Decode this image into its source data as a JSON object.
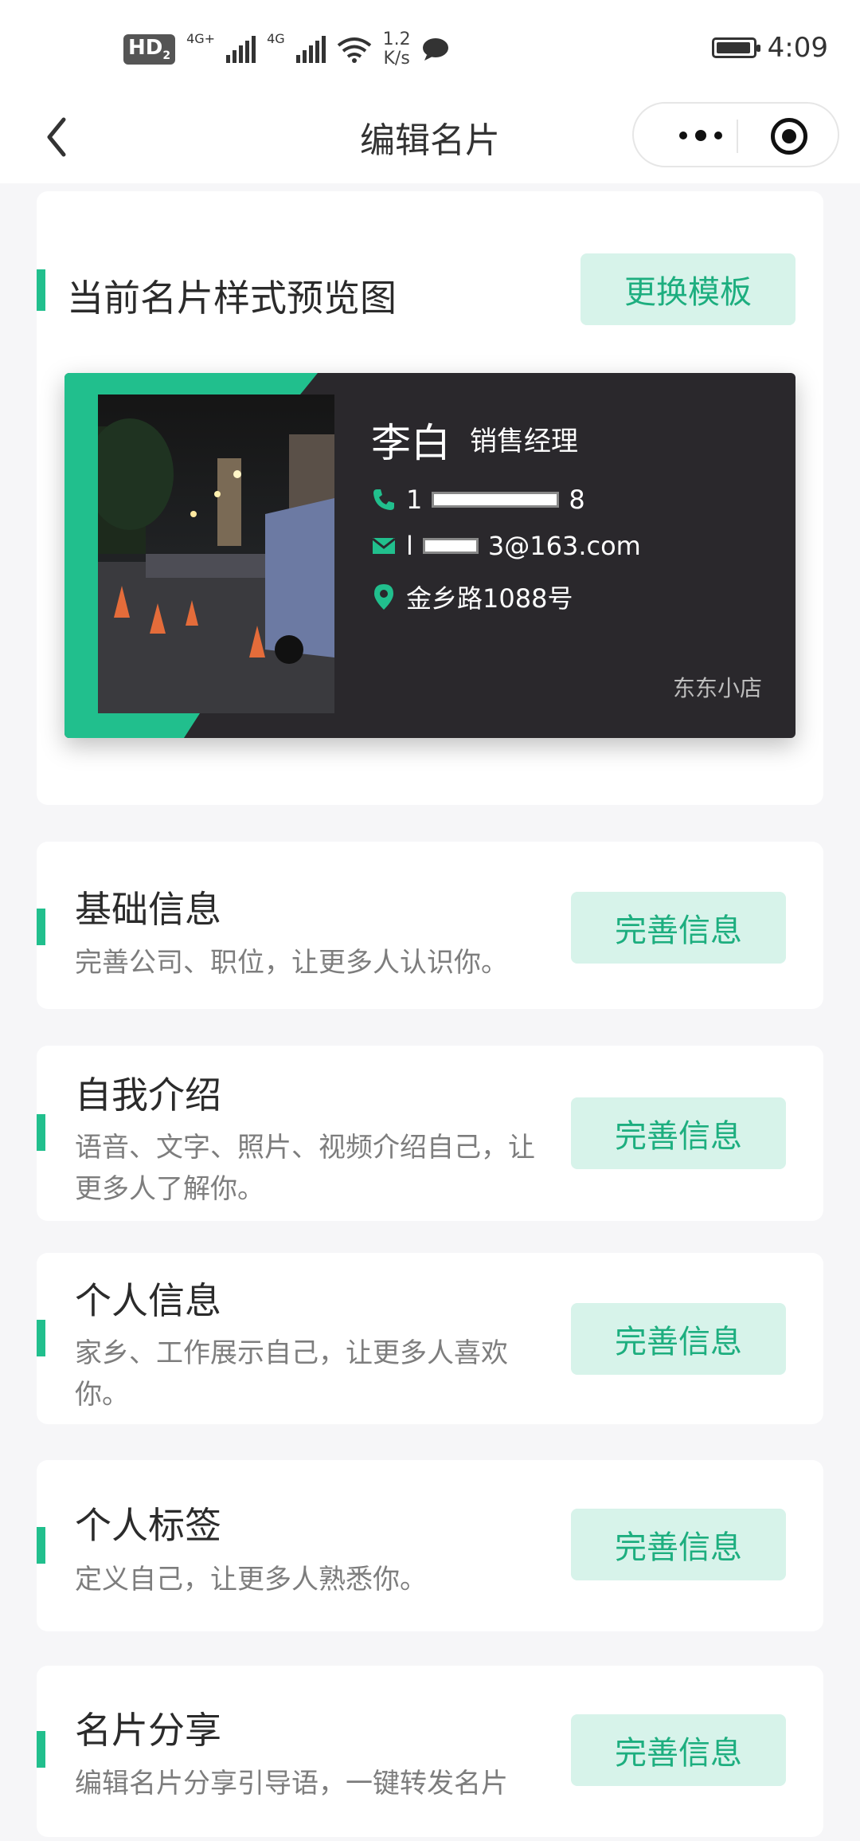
{
  "status_bar": {
    "hd": "HD",
    "hd_sub": "2",
    "sig1_label": "4G+",
    "sig2_label": "4G",
    "speed_value": "1.2",
    "speed_unit": "K/s",
    "time": "4:09"
  },
  "nav": {
    "title": "编辑名片"
  },
  "preview": {
    "title": "当前名片样式预览图",
    "change_template": "更换模板"
  },
  "card": {
    "name": "李白",
    "role": "销售经理",
    "phone_start": "1",
    "phone_end": "8",
    "email_start": "l",
    "email_end": "3@163.com",
    "address": "金乡路1088号",
    "shop": "东东小店",
    "accent_color": "#21bf8d"
  },
  "sections": [
    {
      "title": "基础信息",
      "desc": "完善公司、职位，让更多人认识你。",
      "button": "完善信息"
    },
    {
      "title": "自我介绍",
      "desc": "语音、文字、照片、视频介绍自己，让更多人了解你。",
      "button": "完善信息"
    },
    {
      "title": "个人信息",
      "desc": "家乡、工作展示自己，让更多人喜欢你。",
      "button": "完善信息"
    },
    {
      "title": "个人标签",
      "desc": "定义自己，让更多人熟悉你。",
      "button": "完善信息"
    },
    {
      "title": "名片分享",
      "desc": "编辑名片分享引导语，一键转发名片",
      "button": "完善信息"
    }
  ]
}
